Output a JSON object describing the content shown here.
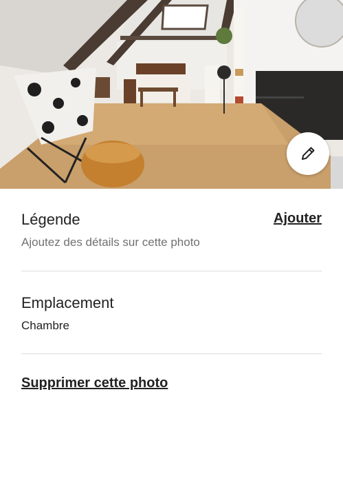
{
  "photo": {
    "alt_icon": "bedroom-photo",
    "edit_icon": "pencil-icon"
  },
  "caption": {
    "title": "Légende",
    "add_label": "Ajouter",
    "placeholder": "Ajoutez des détails sur cette photo"
  },
  "location": {
    "title": "Emplacement",
    "value": "Chambre"
  },
  "actions": {
    "delete_label": "Supprimer cette photo"
  },
  "colors": {
    "text": "#222222",
    "secondary_text": "#717171",
    "divider": "#dddddd",
    "background": "#ffffff"
  }
}
